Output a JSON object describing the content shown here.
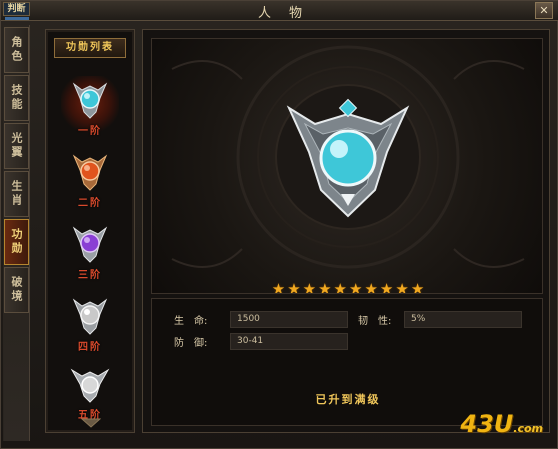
{
  "window": {
    "title": "人物",
    "corner_tag": "判断",
    "close_label": "✕"
  },
  "tabs": [
    {
      "label": "角色",
      "active": false
    },
    {
      "label": "技能",
      "active": false
    },
    {
      "label": "光翼",
      "active": false
    },
    {
      "label": "生肖",
      "active": false
    },
    {
      "label": "功勋",
      "active": true
    },
    {
      "label": "破境",
      "active": false
    }
  ],
  "medal_list": {
    "header": "功勋列表",
    "items": [
      {
        "label": "一阶",
        "gem_color": "#3ec7d8",
        "selected": true
      },
      {
        "label": "二阶",
        "gem_color": "#e0541e",
        "selected": false
      },
      {
        "label": "三阶",
        "gem_color": "#8a3fd4",
        "selected": false
      },
      {
        "label": "四阶",
        "gem_color": "#c9c9c9",
        "selected": false
      },
      {
        "label": "五阶",
        "gem_color": "#d8d8d8",
        "selected": false
      }
    ]
  },
  "showcase": {
    "gem_color": "#3ec7d8",
    "stars_filled": 10,
    "stars_total": 10
  },
  "stats": {
    "life_label": "生　命:",
    "life_value": "1500",
    "defense_label": "防　御:",
    "defense_value": "30-41",
    "toughness_label": "韧　性:",
    "toughness_value": "5%"
  },
  "status_text": "已升到满级",
  "watermark": {
    "main": "43U",
    "suffix": ".com"
  }
}
